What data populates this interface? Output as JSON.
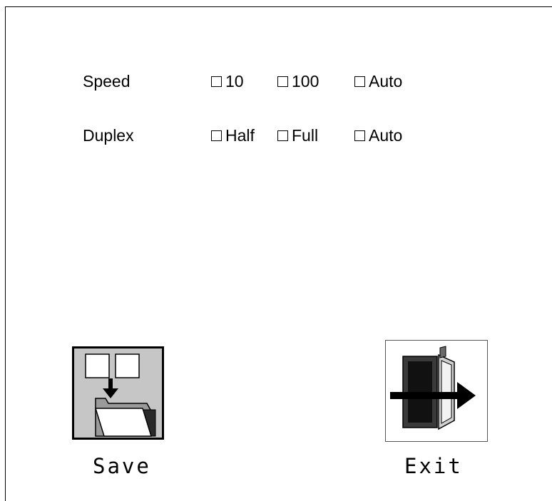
{
  "settings": {
    "speed": {
      "label": "Speed",
      "options": [
        "10",
        "100",
        "Auto"
      ]
    },
    "duplex": {
      "label": "Duplex",
      "options": [
        "Half",
        "Full",
        "Auto"
      ]
    }
  },
  "buttons": {
    "save_label": "Save",
    "exit_label": "Exit"
  },
  "icons": {
    "save": "save-folder-icon",
    "exit": "exit-door-icon"
  },
  "colors": {
    "save_bg": "#c6c6c6",
    "icon_dark": "#1a1a1a"
  }
}
